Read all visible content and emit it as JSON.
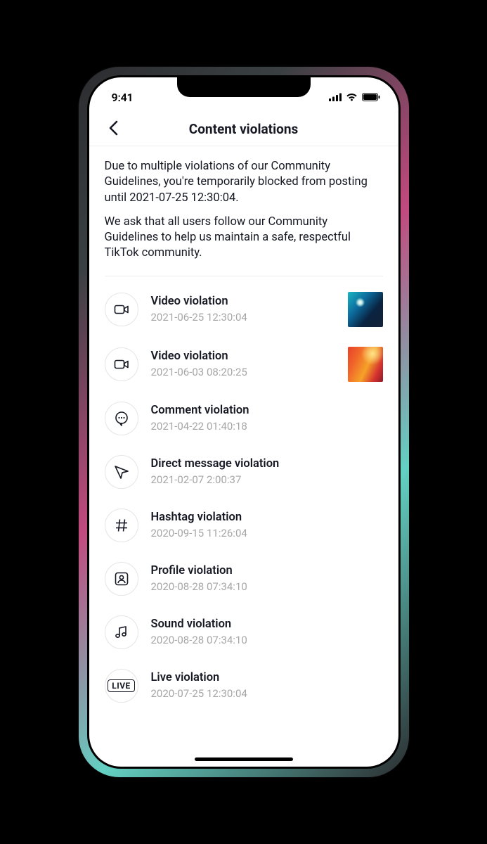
{
  "status": {
    "time": "9:41"
  },
  "header": {
    "title": "Content violations"
  },
  "description": {
    "p1": "Due to multiple violations of our Community Guidelines, you're temporarily blocked from posting until 2021-07-25 12:30:04.",
    "p2": "We ask that all users follow our Community Guidelines to help us maintain a safe, respectful TikTok community."
  },
  "violations": [
    {
      "icon": "video",
      "title": "Video violation",
      "date": "2021-06-25 12:30:04",
      "thumb": "thumb-1"
    },
    {
      "icon": "video",
      "title": "Video violation",
      "date": "2021-06-03 08:20:25",
      "thumb": "thumb-2"
    },
    {
      "icon": "comment",
      "title": "Comment violation",
      "date": "2021-04-22 01:40:18"
    },
    {
      "icon": "dm",
      "title": "Direct message violation",
      "date": "2021-02-07 2:00:37"
    },
    {
      "icon": "hashtag",
      "title": "Hashtag violation",
      "date": "2020-09-15 11:26:04"
    },
    {
      "icon": "profile",
      "title": "Profile violation",
      "date": "2020-08-28 07:34:10"
    },
    {
      "icon": "sound",
      "title": "Sound violation",
      "date": "2020-08-28 07:34:10"
    },
    {
      "icon": "live",
      "title": "Live violation",
      "date": "2020-07-25 12:30:04"
    }
  ],
  "liveBadge": "LIVE"
}
